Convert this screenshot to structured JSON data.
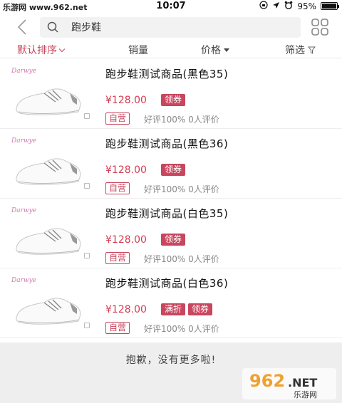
{
  "status_bar": {
    "watermark": "乐游网 www.962.net",
    "time": "10:07",
    "battery": "95%"
  },
  "search": {
    "value": "跑步鞋",
    "placeholder": ""
  },
  "sort_bar": {
    "items": [
      {
        "label": "默认排序",
        "active": true
      },
      {
        "label": "销量",
        "active": false
      },
      {
        "label": "价格",
        "active": false
      },
      {
        "label": "筛选",
        "active": false
      }
    ]
  },
  "products": [
    {
      "title": "跑步鞋测试商品(黑色35)",
      "price": "¥128.00",
      "tags": [
        "领券"
      ],
      "self_operated": "自营",
      "rating": "好评100% 0人评价",
      "brand": "Darwye"
    },
    {
      "title": "跑步鞋测试商品(黑色36)",
      "price": "¥128.00",
      "tags": [
        "领券"
      ],
      "self_operated": "自营",
      "rating": "好评100% 0人评价",
      "brand": "Darwye"
    },
    {
      "title": "跑步鞋测试商品(白色35)",
      "price": "¥128.00",
      "tags": [
        "领券"
      ],
      "self_operated": "自营",
      "rating": "好评100% 0人评价",
      "brand": "Darwye"
    },
    {
      "title": "跑步鞋测试商品(白色36)",
      "price": "¥128.00",
      "tags": [
        "满折",
        "领券"
      ],
      "self_operated": "自营",
      "rating": "好评100% 0人评价",
      "brand": "Darwye"
    }
  ],
  "footer": {
    "message": "抱歉，没有更多啦!",
    "watermark_logo": "962.NET",
    "watermark_sub": "乐游网"
  },
  "colors": {
    "accent": "#c8465e",
    "price": "#d43c52"
  },
  "icons": {
    "back": "chevron-left-icon",
    "search": "search-icon",
    "grid": "grid-view-icon",
    "filter": "filter-icon"
  }
}
